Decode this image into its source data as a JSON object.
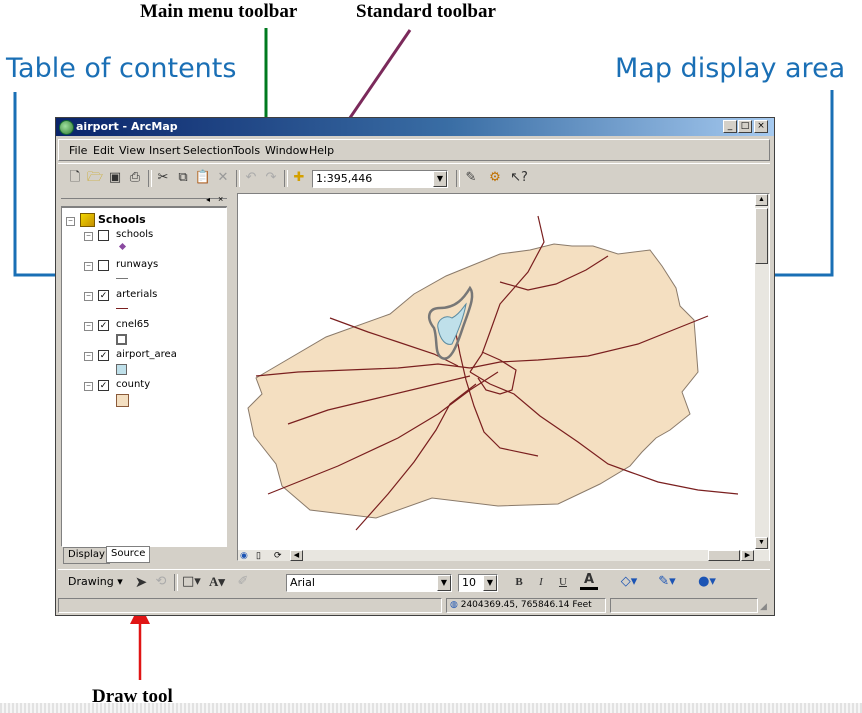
{
  "annotations": {
    "main_menu_toolbar": "Main menu toolbar",
    "standard_toolbar": "Standard toolbar",
    "table_of_contents": "Table of contents",
    "map_display_area": "Map display area",
    "draw_tool": "Draw tool"
  },
  "colors": {
    "annotation_blue": "#1a6fb5",
    "arrow_green": "#007a1f",
    "arrow_purple": "#7b2a5b",
    "arrow_red": "#e01414",
    "county_fill": "#f4dfc1",
    "road_color": "#7a1f1f"
  },
  "window": {
    "title": "airport - ArcMap",
    "controls": [
      "_",
      "□",
      "×"
    ]
  },
  "menu": [
    "File",
    "Edit",
    "View",
    "Insert",
    "Selection",
    "Tools",
    "Window",
    "Help"
  ],
  "standard_toolbar": {
    "scale": "1:395,446",
    "icons": [
      "new-icon",
      "open-icon",
      "save-icon",
      "print-icon",
      "cut-icon",
      "copy-icon",
      "paste-icon",
      "delete-icon",
      "undo-icon",
      "redo-icon",
      "add-data-icon",
      "editor-icon",
      "arctoolbox-icon",
      "whats-this-icon"
    ]
  },
  "toc": {
    "data_frame": "Schools",
    "layers": [
      {
        "name": "schools",
        "checked": false
      },
      {
        "name": "runways",
        "checked": false
      },
      {
        "name": "arterials",
        "checked": true
      },
      {
        "name": "cnel65",
        "checked": true
      },
      {
        "name": "airport_area",
        "checked": true
      },
      {
        "name": "county",
        "checked": true
      }
    ],
    "tabs": [
      "Display",
      "Source"
    ]
  },
  "draw_toolbar": {
    "drawing_label": "Drawing",
    "font": "Arial",
    "size": "10",
    "bold": "B",
    "italic": "I",
    "underline": "U",
    "font_color_letter": "A"
  },
  "status": {
    "coordinates": "2404369.45, 765846.14 Feet"
  }
}
